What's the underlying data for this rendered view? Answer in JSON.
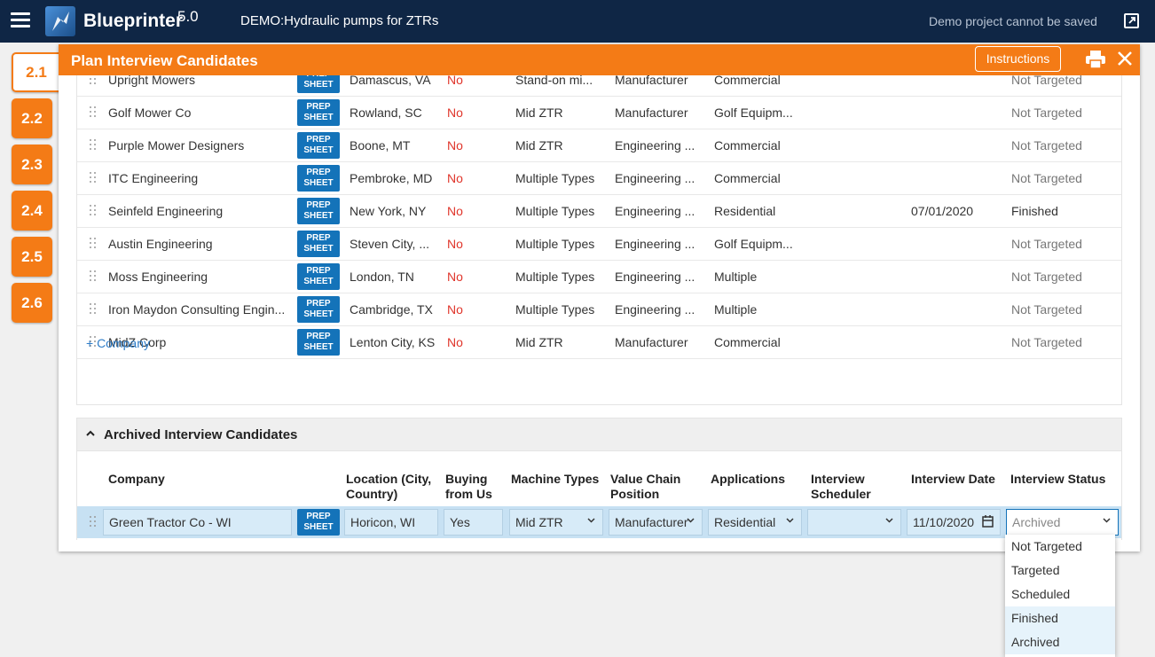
{
  "app": {
    "name": "Blueprinter",
    "version": "5.0",
    "project": "DEMO:Hydraulic pumps for ZTRs",
    "notice": "Demo project cannot be saved"
  },
  "steps": [
    "2.1",
    "2.2",
    "2.3",
    "2.4",
    "2.5",
    "2.6"
  ],
  "panel": {
    "title": "Plan Interview Candidates",
    "instructions_label": "Instructions"
  },
  "prep_label_1": "PREP",
  "prep_label_2": "SHEET",
  "candidates": [
    {
      "company": "Upright Mowers",
      "location": "Damascus, VA",
      "buying": "No",
      "machine": "Stand-on mi...",
      "chain": "Manufacturer",
      "application": "Commercial",
      "date": "",
      "status": "Not Targeted"
    },
    {
      "company": "Golf Mower Co",
      "location": "Rowland, SC",
      "buying": "No",
      "machine": "Mid ZTR",
      "chain": "Manufacturer",
      "application": "Golf Equipm...",
      "date": "",
      "status": "Not Targeted"
    },
    {
      "company": "Purple Mower Designers",
      "location": "Boone, MT",
      "buying": "No",
      "machine": "Mid ZTR",
      "chain": "Engineering ...",
      "application": "Commercial",
      "date": "",
      "status": "Not Targeted"
    },
    {
      "company": "ITC Engineering",
      "location": "Pembroke, MD",
      "buying": "No",
      "machine": "Multiple Types",
      "chain": "Engineering ...",
      "application": "Commercial",
      "date": "",
      "status": "Not Targeted"
    },
    {
      "company": "Seinfeld Engineering",
      "location": "New York, NY",
      "buying": "No",
      "machine": "Multiple Types",
      "chain": "Engineering ...",
      "application": "Residential",
      "date": "07/01/2020",
      "status": "Finished"
    },
    {
      "company": "Austin Engineering",
      "location": "Steven City, ...",
      "buying": "No",
      "machine": "Multiple Types",
      "chain": "Engineering ...",
      "application": "Golf Equipm...",
      "date": "",
      "status": "Not Targeted"
    },
    {
      "company": "Moss Engineering",
      "location": "London, TN",
      "buying": "No",
      "machine": "Multiple Types",
      "chain": "Engineering ...",
      "application": "Multiple",
      "date": "",
      "status": "Not Targeted"
    },
    {
      "company": "Iron Maydon Consulting Engin...",
      "location": "Cambridge, TX",
      "buying": "No",
      "machine": "Multiple Types",
      "chain": "Engineering ...",
      "application": "Multiple",
      "date": "",
      "status": "Not Targeted"
    },
    {
      "company": "MidZ Corp",
      "location": "Lenton City, KS",
      "buying": "No",
      "machine": "Mid ZTR",
      "chain": "Manufacturer",
      "application": "Commercial",
      "date": "",
      "status": "Not Targeted"
    }
  ],
  "add_company_label": "+ Company",
  "archived": {
    "title": "Archived Interview Candidates",
    "headers": {
      "company": "Company",
      "location_1": "Location (City,",
      "location_2": "Country)",
      "buying_1": "Buying",
      "buying_2": "from Us",
      "machine": "Machine Types",
      "chain_1": "Value Chain",
      "chain_2": "Position",
      "applications": "Applications",
      "scheduler_1": "Interview",
      "scheduler_2": "Scheduler",
      "date": "Interview Date",
      "status": "Interview Status"
    },
    "row": {
      "company": "Green Tractor Co - WI",
      "location": "Horicon, WI",
      "buying": "Yes",
      "machine": "Mid ZTR",
      "chain": "Manufacturer",
      "application": "Residential",
      "scheduler": "",
      "date": "11/10/2020",
      "status": "Archived"
    }
  },
  "status_options": [
    "Not Targeted",
    "Targeted",
    "Scheduled",
    "Finished",
    "Archived"
  ],
  "colors": {
    "topbar": "#0f2645",
    "accent": "#f47b16",
    "prep": "#1473b9",
    "no": "#e0352b",
    "yes": "#3cae3c"
  }
}
